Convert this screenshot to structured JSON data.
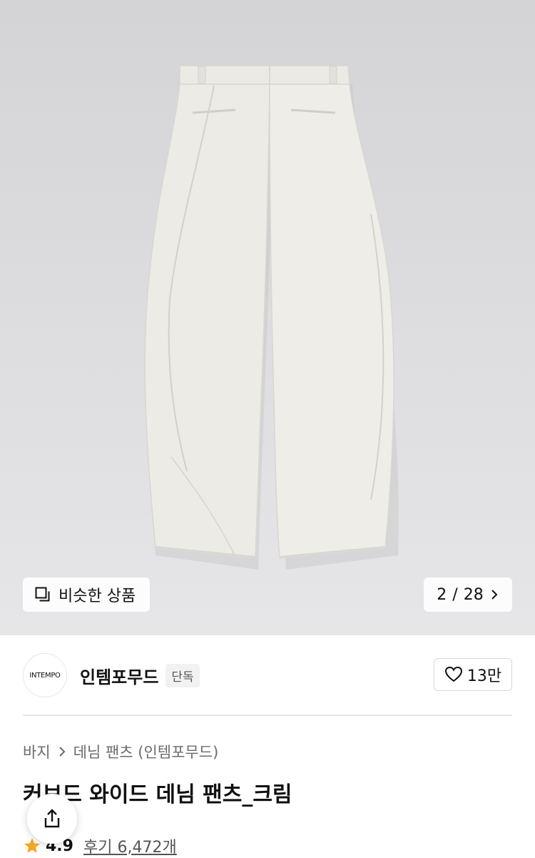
{
  "hero": {
    "similar_label": "비슷한 상품",
    "counter_current": "2",
    "counter_separator": "/",
    "counter_total": "28"
  },
  "brand": {
    "logo_text": "INTEMPO",
    "name": "인템포무드",
    "tag": "단독",
    "likes": "13만"
  },
  "breadcrumb": {
    "items": [
      "바지",
      "데님 팬츠 (인템포무드)"
    ]
  },
  "product": {
    "title": "커브드 와이드 데님 팬츠_크림",
    "rating": "4.9",
    "review_label": "후기 6,472개"
  },
  "colors": {
    "star": "#F5A623",
    "hero_bg": "#DCDCDE",
    "pants": "#ECEBE6"
  },
  "icons": {
    "similar": "similar-items-icon",
    "chevron": "chevron-right-icon",
    "heart": "heart-outline-icon",
    "share": "share-icon",
    "star": "star-icon"
  }
}
